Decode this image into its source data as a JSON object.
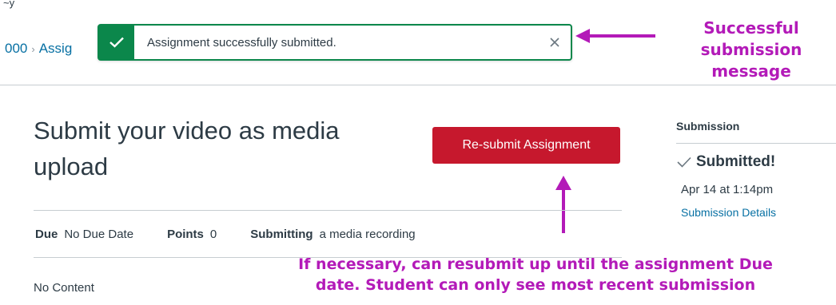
{
  "header": {
    "top_fragment": "~y",
    "breadcrumb": [
      "000",
      "Assig"
    ]
  },
  "flash": {
    "message": "Assignment successfully submitted.",
    "icon": "check-icon",
    "close_icon": "close-icon",
    "color": "#0b874b"
  },
  "annotations": {
    "top": [
      "Successful",
      "submission",
      "message"
    ],
    "bottom": [
      "If necessary, can resubmit up until the assignment Due",
      "date. Student can only see most recent submission"
    ],
    "color": "#b31ab8"
  },
  "assignment": {
    "title_line1": "Submit your video as media",
    "title_line2": "upload",
    "resubmit_label": "Re-submit Assignment",
    "button_color": "#c6182d",
    "due_label": "Due",
    "due_value": "No Due Date",
    "points_label": "Points",
    "points_value": "0",
    "submitting_label": "Submitting",
    "submitting_value": "a media recording",
    "content": "No Content"
  },
  "sidebar": {
    "title": "Submission",
    "status": "Submitted!",
    "status_icon": "checkmark-icon",
    "date": "Apr 14 at 1:14pm",
    "details_link": "Submission Details",
    "link_color": "#0770a3"
  }
}
